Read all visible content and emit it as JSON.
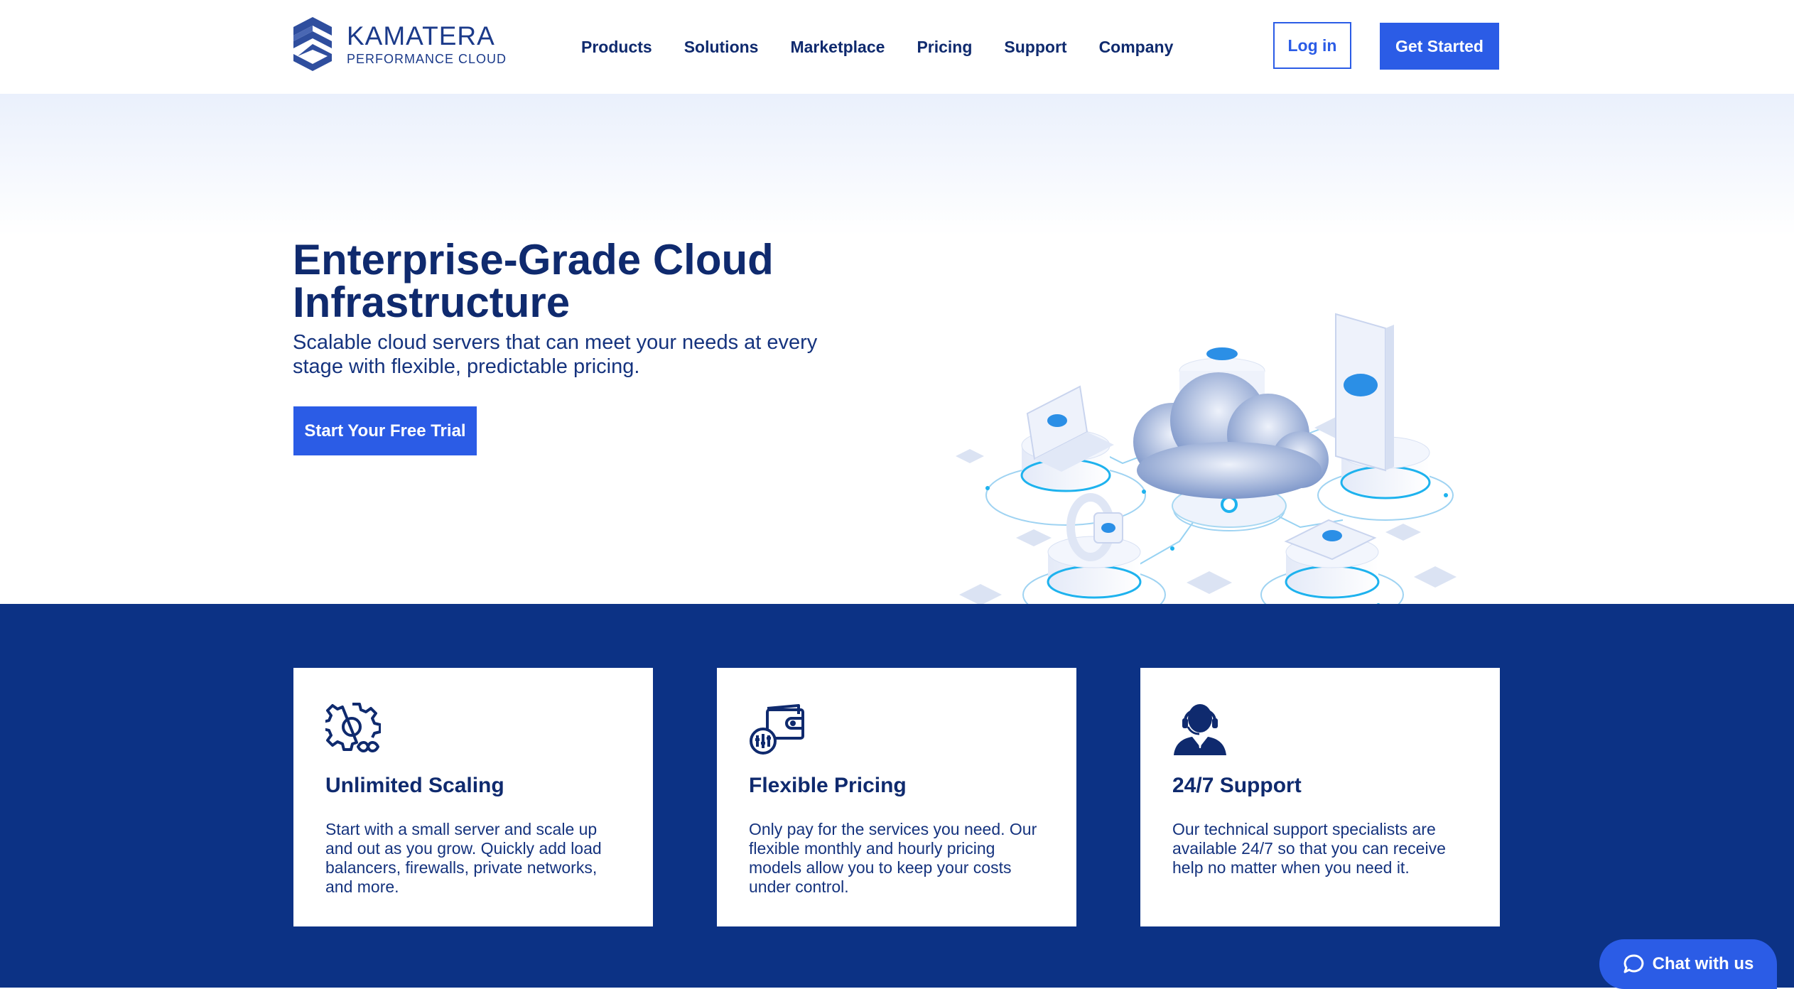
{
  "brand": {
    "name": "KAMATERA",
    "tagline": "PERFORMANCE CLOUD"
  },
  "nav": [
    "Products",
    "Solutions",
    "Marketplace",
    "Pricing",
    "Support",
    "Company"
  ],
  "header": {
    "login_label": "Log in",
    "get_started_label": "Get Started"
  },
  "hero": {
    "title": "Enterprise-Grade Cloud Infrastructure",
    "subtitle": "Scalable cloud servers that can meet your needs at every stage with flexible, predictable pricing.",
    "cta_label": "Start Your Free Trial"
  },
  "features": [
    {
      "icon": "gear-infinity-icon",
      "title": "Unlimited Scaling",
      "text": "Start with a small server and scale up and out as you grow. Quickly add load balancers, firewalls, private networks, and more."
    },
    {
      "icon": "wallet-icon",
      "title": "Flexible Pricing",
      "text": "Only pay for the services you need. Our flexible monthly and hourly pricing models allow you to keep your costs under control."
    },
    {
      "icon": "support-agent-icon",
      "title": "24/7 Support",
      "text": "Our technical support specialists are available 24/7 so that you can receive help no matter when you need it."
    }
  ],
  "chat": {
    "label": "Chat with us",
    "icon": "chat-bubble-icon"
  },
  "colors": {
    "primary": "#2b5ce6",
    "navy": "#0c3285",
    "text": "#0f2a6e"
  }
}
